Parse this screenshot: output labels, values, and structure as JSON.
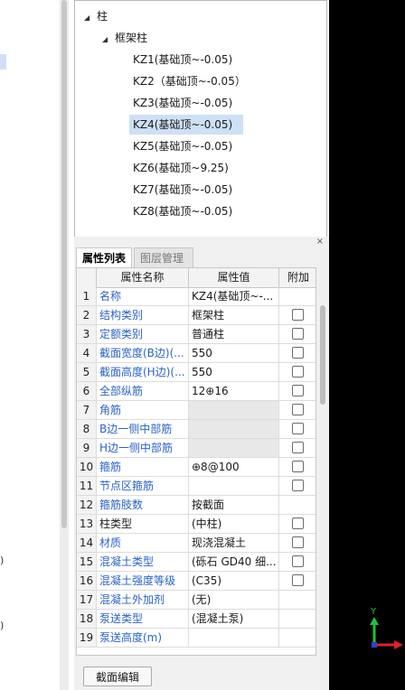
{
  "left_glyphs": [
    ")",
    ")"
  ],
  "tree": {
    "root": "柱",
    "group": "框架柱",
    "items": [
      "KZ1(基础顶~-0.05)",
      "KZ2（基础顶~-0.05）",
      "KZ3(基础顶~-0.05)",
      "KZ4(基础顶~-0.05)",
      "KZ5(基础顶~-0.05)",
      "KZ6(基础顶~9.25)",
      "KZ7(基础顶~-0.05)",
      "KZ8(基础顶~-0.05)"
    ],
    "selected_index": 3
  },
  "panel": {
    "close": "×",
    "tabs": [
      "属性列表",
      "图层管理"
    ],
    "columns": [
      "属性名称",
      "属性值",
      "附加"
    ],
    "rows": [
      {
        "idx": "1",
        "name": "名称",
        "value": "KZ4(基础顶~-...",
        "check": false
      },
      {
        "idx": "2",
        "name": "结构类别",
        "value": "框架柱",
        "check": true
      },
      {
        "idx": "3",
        "name": "定额类别",
        "value": "普通柱",
        "check": true
      },
      {
        "idx": "4",
        "name": "截面宽度(B边)(...",
        "value": "550",
        "check": true
      },
      {
        "idx": "5",
        "name": "截面高度(H边)(...",
        "value": "550",
        "check": true
      },
      {
        "idx": "6",
        "name": "全部纵筋",
        "value": "12⊕16",
        "check": true
      },
      {
        "idx": "7",
        "name": "角筋",
        "value": "",
        "check": true,
        "grey": true
      },
      {
        "idx": "8",
        "name": "B边一侧中部筋",
        "value": "",
        "check": true,
        "grey": true
      },
      {
        "idx": "9",
        "name": "H边一侧中部筋",
        "value": "",
        "check": true,
        "grey": true
      },
      {
        "idx": "10",
        "name": "箍筋",
        "value": "⊕8@100",
        "check": true
      },
      {
        "idx": "11",
        "name": "节点区箍筋",
        "value": "",
        "check": true
      },
      {
        "idx": "12",
        "name": "箍筋肢数",
        "value": "按截面",
        "check": false
      },
      {
        "idx": "13",
        "name": "柱类型",
        "value": "(中柱)",
        "check": true,
        "black": true
      },
      {
        "idx": "14",
        "name": "材质",
        "value": "现浇混凝土",
        "check": true
      },
      {
        "idx": "15",
        "name": "混凝土类型",
        "value": "(砾石 GD40 细...",
        "check": true
      },
      {
        "idx": "16",
        "name": "混凝土强度等级",
        "value": "(C35)",
        "check": true
      },
      {
        "idx": "17",
        "name": "混凝土外加剂",
        "value": "(无)",
        "check": false
      },
      {
        "idx": "18",
        "name": "泵送类型",
        "value": "(混凝土泵)",
        "check": false
      },
      {
        "idx": "19",
        "name": "泵送高度(m)",
        "value": "",
        "check": false
      }
    ],
    "edit_button": "截面编辑"
  },
  "axes": {
    "x_color": "#e0202a",
    "y_color": "#22c13a",
    "origin_color": "#3040d0",
    "y_label": "Y"
  }
}
